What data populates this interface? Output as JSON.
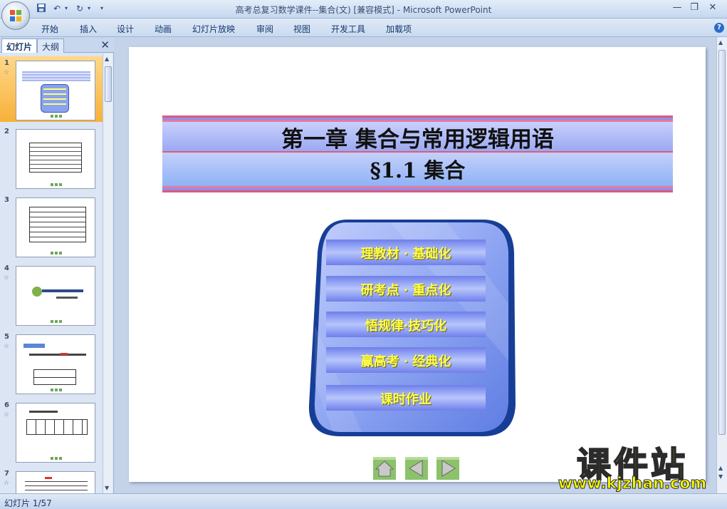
{
  "window": {
    "title": "高考总复习数学课件--集合(文) [兼容模式] - Microsoft PowerPoint",
    "controls": [
      "minimize",
      "restore",
      "close"
    ]
  },
  "ribbon": {
    "tabs": [
      "开始",
      "插入",
      "设计",
      "动画",
      "幻灯片放映",
      "审阅",
      "视图",
      "开发工具",
      "加载项"
    ]
  },
  "panel": {
    "tabs": {
      "slides": "幻灯片",
      "outline": "大纲"
    },
    "thumbnails": [
      {
        "number": "1",
        "selected": true,
        "has_animation": true
      },
      {
        "number": "2",
        "selected": false,
        "has_animation": false
      },
      {
        "number": "3",
        "selected": false,
        "has_animation": false
      },
      {
        "number": "4",
        "selected": false,
        "has_animation": true
      },
      {
        "number": "5",
        "selected": false,
        "has_animation": true
      },
      {
        "number": "6",
        "selected": false,
        "has_animation": true
      },
      {
        "number": "7",
        "selected": false,
        "has_animation": true
      }
    ]
  },
  "slide": {
    "title_line1": "第一章  集合与常用逻辑用语",
    "title_line2": "§1.1   集合",
    "menu": [
      "理教材 · 基础化",
      "研考点 · 重点化",
      "悟规律·技巧化",
      "赢高考 · 经典化",
      "课时作业"
    ],
    "nav_buttons": [
      "home-icon",
      "previous-icon",
      "next-icon"
    ]
  },
  "watermark": {
    "title": "课件站",
    "url": "www.kjzhan.com"
  },
  "status": {
    "slide_counter": "幻灯片 1/57"
  },
  "colors": {
    "ribbon": "#c9daf0",
    "selected_thumb": "#f7b13a",
    "menu_text": "#ffff4a",
    "menu_panel": "#7c98ef",
    "watermark": "#ffff00"
  }
}
